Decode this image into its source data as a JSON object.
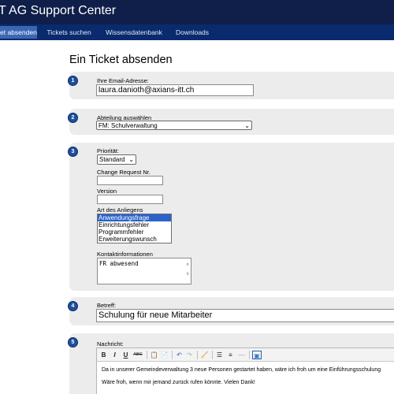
{
  "app": {
    "title": "T AG Support Center"
  },
  "nav": {
    "tabs": [
      {
        "label": "et absenden"
      },
      {
        "label": "Tickets suchen"
      },
      {
        "label": "Wissensdatenbank"
      },
      {
        "label": "Downloads"
      }
    ]
  },
  "page": {
    "title": "Ein Ticket absenden"
  },
  "steps": {
    "s1": {
      "num": "1",
      "label": "Ihre Email-Adresse:",
      "value": "laura.danioth@axians-itt.ch"
    },
    "s2": {
      "num": "2",
      "label": "Abteilung auswählen",
      "value": "FM: Schulverwaltung"
    },
    "s3": {
      "num": "3",
      "priority_label": "Priorität:",
      "priority_value": "Standard",
      "change_request_label": "Change Request Nr.",
      "version_label": "Version",
      "type_label": "Art des Anliegens",
      "type_options": [
        "Anwendungsfrage",
        "Einrichtungsfehler",
        "Programmfehler",
        "Erweiterungswunsch"
      ],
      "contact_label": "Kontaktinformationen",
      "contact_value": "FR abwesend"
    },
    "s4": {
      "num": "4",
      "label": "Betreff:",
      "value": "Schulung für neue Mitarbeiter"
    },
    "s5": {
      "num": "5",
      "label": "Nachricht:",
      "line1": "Da in unserer Gemeindeverwaltung 3 neue Personen gestartet haben, wäre ich froh um eine Einführungsschulung",
      "line2": "Wäre froh, wenn mir jemand zurück rufen könnte. Vielen Dank!"
    }
  },
  "toolbar": {
    "bold": "B",
    "italic": "I",
    "underline": "U",
    "strike": "ABC",
    "paste": "📋",
    "paste_text": "📄",
    "undo": "↶",
    "redo": "↷",
    "clean": "🧹",
    "bullets": "☰",
    "numbers": "≡",
    "rule": "—",
    "image": "▣"
  }
}
